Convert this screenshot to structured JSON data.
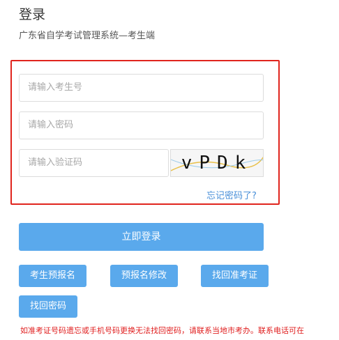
{
  "header": {
    "title": "登录",
    "subtitle": "广东省自学考试管理系统—考生端"
  },
  "form": {
    "exam_number_placeholder": "请输入考生号",
    "password_placeholder": "请输入密码",
    "captcha_placeholder": "请输入验证码",
    "captcha_text": "vPDk",
    "forgot_password": "忘记密码了?"
  },
  "buttons": {
    "login": "立即登录",
    "pre_register": "考生预报名",
    "edit_pre_register": "预报名修改",
    "recover_admission": "找回准考证",
    "recover_password": "找回密码"
  },
  "notice": "如准考证号码遗忘或手机号码更换无法找回密码，请联系当地市考办。联系电话可在",
  "colors": {
    "primary_button": "#5aa9ec",
    "highlight_border": "#e0241d",
    "link": "#4a90d9",
    "notice": "#e02020"
  }
}
